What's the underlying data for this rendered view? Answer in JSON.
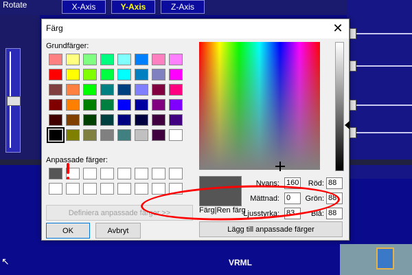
{
  "background": {
    "rotate_label": "Rotate",
    "tabs": [
      {
        "label": "X-Axis",
        "active": false
      },
      {
        "label": "Y-Axis",
        "active": true
      },
      {
        "label": "Z-Axis",
        "active": false
      }
    ],
    "vrml_label": "VRML"
  },
  "dialog": {
    "title": "Färg",
    "close_glyph": "✕",
    "basic_colors_label": "Grundfärger:",
    "basic_colors": [
      "#ff8080",
      "#ffff80",
      "#80ff80",
      "#00ff80",
      "#80ffff",
      "#0080ff",
      "#ff80c0",
      "#ff80ff",
      "#ff0000",
      "#ffff00",
      "#80ff00",
      "#00ff40",
      "#00ffff",
      "#0080c0",
      "#8080c0",
      "#ff00ff",
      "#804040",
      "#ff8040",
      "#00ff00",
      "#008080",
      "#004080",
      "#8080ff",
      "#800040",
      "#ff0080",
      "#800000",
      "#ff8000",
      "#008000",
      "#008040",
      "#0000ff",
      "#0000a0",
      "#800080",
      "#8000ff",
      "#400000",
      "#804000",
      "#004000",
      "#004040",
      "#000080",
      "#000040",
      "#400040",
      "#400080",
      "#000000",
      "#808000",
      "#808040",
      "#808080",
      "#408080",
      "#c0c0c0",
      "#400040",
      "#ffffff"
    ],
    "selected_basic_index": 40,
    "custom_colors_label": "Anpassade färger:",
    "custom_colors": [
      "#555555",
      "#ffffff",
      "#ffffff",
      "#ffffff",
      "#ffffff",
      "#ffffff",
      "#ffffff",
      "#ffffff",
      "#ffffff",
      "#ffffff",
      "#ffffff",
      "#ffffff",
      "#ffffff",
      "#ffffff",
      "#ffffff",
      "#ffffff"
    ],
    "define_custom_label": "Definiera anpassade färger >>",
    "ok_label": "OK",
    "cancel_label": "Avbryt",
    "color_solid_label": "Färg|Ren färg",
    "add_custom_label": "Lägg till anpassade färger",
    "preview_color": "#555555",
    "hue_label": "Nyans:",
    "hue_value": "160",
    "sat_label": "Mättnad:",
    "sat_value": "0",
    "lum_label": "Ljusstyrka:",
    "lum_value": "83",
    "red_label": "Röd:",
    "red_value": "88",
    "green_label": "Grön:",
    "green_value": "88",
    "blue_label": "Blå:",
    "blue_value": "88"
  },
  "annotations": {
    "highlight_color": "#ff0000"
  }
}
